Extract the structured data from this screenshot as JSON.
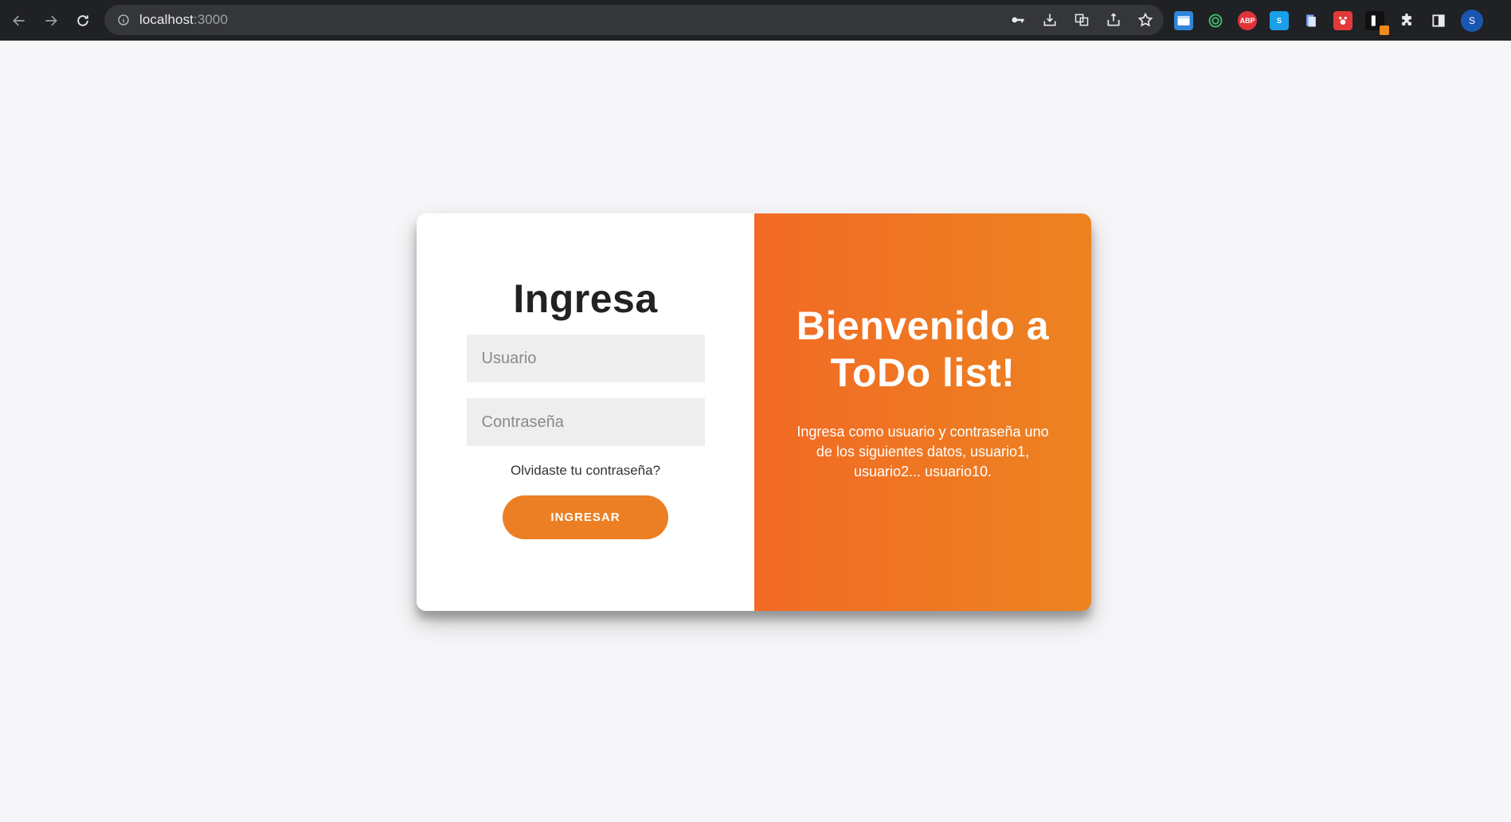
{
  "browser": {
    "url_host": "localhost",
    "url_port": ":3000",
    "extensions": [
      "window-ext-icon",
      "target-ext-icon",
      "ABP",
      "S",
      "doc-ext-icon",
      "paw-ext-icon",
      "tag-ext-icon"
    ],
    "avatar_letter": "S"
  },
  "login": {
    "title": "Ingresa",
    "username_placeholder": "Usuario",
    "password_placeholder": "Contraseña",
    "forgot_link": "Olvidaste tu contraseña?",
    "submit_label": "INGRESAR"
  },
  "welcome": {
    "title": "Bienvenido a ToDo list!",
    "message": "Ingresa como usuario y contraseña uno de los siguientes datos, usuario1, usuario2... usuario10."
  },
  "colors": {
    "accent": "#ec7f24",
    "panel_gradient_start": "#f26a25",
    "panel_gradient_end": "#ec8320",
    "page_background": "#f6f6f8"
  }
}
